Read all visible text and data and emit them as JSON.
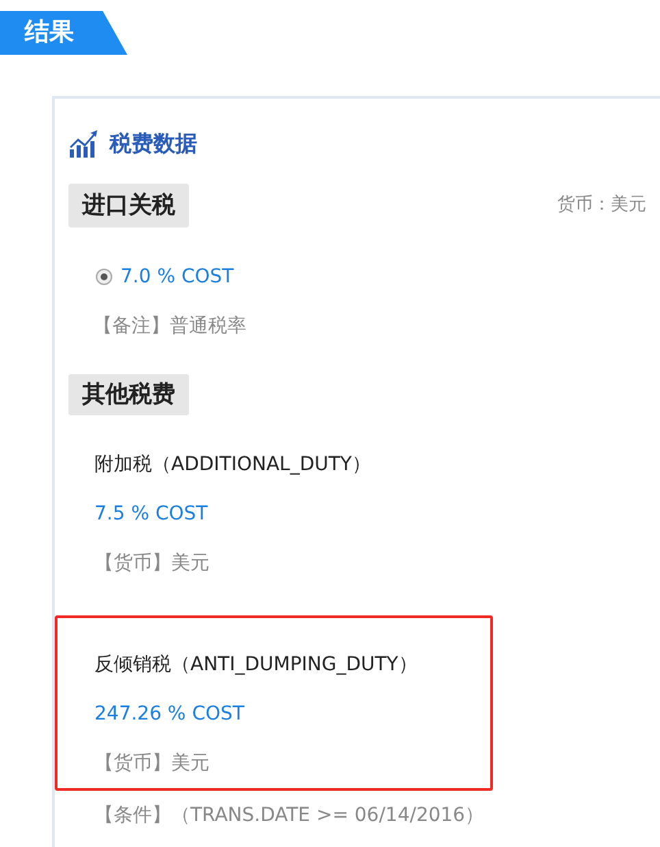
{
  "header": {
    "title": "结果"
  },
  "panel": {
    "title": "税费数据",
    "import_duty": {
      "label": "进口关税",
      "currency": "货币：美元",
      "options": [
        {
          "rate": "7.0 % COST",
          "selected": true
        }
      ],
      "note": "【备注】普通税率"
    },
    "other_fees": {
      "label": "其他税费",
      "items": [
        {
          "name": "附加税（ADDITIONAL_DUTY）",
          "rate": "7.5 % COST",
          "currency": "【货币】美元",
          "highlighted": false
        },
        {
          "name": "反倾销税（ANTI_DUMPING_DUTY）",
          "rate": "247.26 % COST",
          "currency": "【货币】美元",
          "highlighted": true,
          "condition": "【条件】（TRANS.DATE >= 06/14/2016）"
        }
      ]
    }
  }
}
